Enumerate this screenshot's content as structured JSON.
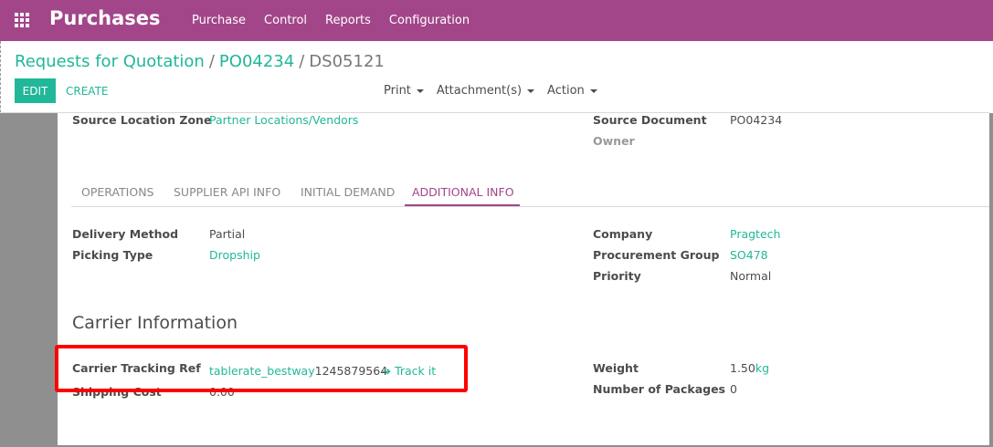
{
  "navbar": {
    "app_title": "Purchases",
    "menu": [
      "Purchase",
      "Control",
      "Reports",
      "Configuration"
    ]
  },
  "breadcrumb": {
    "items": [
      "Requests for Quotation",
      "PO04234"
    ],
    "separator": "/",
    "current": "DS05121"
  },
  "buttons": {
    "edit": "EDIT",
    "create": "CREATE"
  },
  "actions": {
    "print": "Print",
    "attachments": "Attachment(s)",
    "action": "Action"
  },
  "header_fields": {
    "source_location_zone_label": "Source Location Zone",
    "source_location_zone_value": "Partner Locations/Vendors",
    "source_document_label": "Source Document",
    "source_document_value": "PO04234",
    "owner_label": "Owner"
  },
  "tabs": [
    "OPERATIONS",
    "SUPPLIER API INFO",
    "INITIAL DEMAND",
    "ADDITIONAL INFO"
  ],
  "active_tab": "ADDITIONAL INFO",
  "additional_info": {
    "delivery_method_label": "Delivery Method",
    "delivery_method_value": "Partial",
    "picking_type_label": "Picking Type",
    "picking_type_value": "Dropship",
    "company_label": "Company",
    "company_value": "Pragtech",
    "procurement_group_label": "Procurement Group",
    "procurement_group_value": "SO478",
    "priority_label": "Priority",
    "priority_value": "Normal"
  },
  "carrier": {
    "section_title": "Carrier Information",
    "tracking_ref_label": "Carrier Tracking Ref",
    "tracking_ref_link": "tablerate_bestway",
    "tracking_ref_number": "1245879564",
    "track_it": "Track it",
    "shipping_cost_label": "Shipping Cost",
    "shipping_cost_value": "0.00",
    "weight_label": "Weight",
    "weight_value": "1.50",
    "weight_unit": "kg",
    "packages_label": "Number of Packages",
    "packages_value": "0"
  },
  "colors": {
    "brand": "#a24689",
    "accent": "#21b799",
    "highlight": "#ff0000"
  }
}
